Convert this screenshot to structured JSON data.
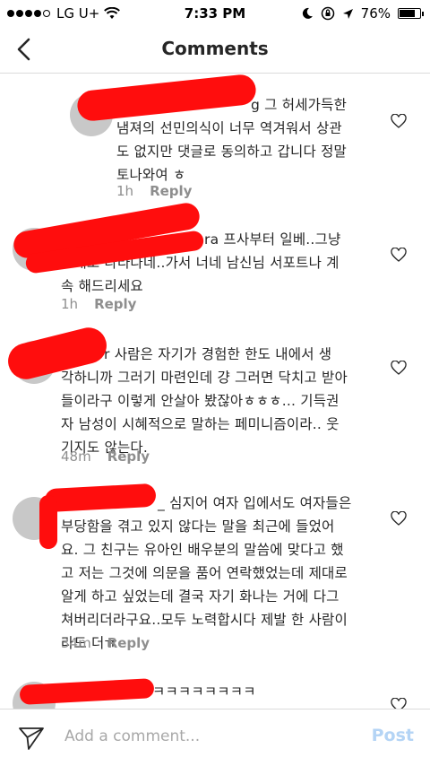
{
  "status_bar": {
    "carrier": "LG U+",
    "time": "7:33 PM",
    "battery": "76%",
    "battery_level": 0.76
  },
  "nav": {
    "title": "Comments"
  },
  "comments": [
    {
      "lines": [
        "g 그 허세가득한",
        "냄져의 선민의식이 너무 역겨워서 상관",
        "도 없지만 댓글로 동의하고 갑니다 정말",
        "토나와여 ㅎ"
      ],
      "time": "1h",
      "reply": "Reply"
    },
    {
      "lines": [
        "ra 프사부터 일베..그냥",
        "그대로 나타나네..가서 너네 남신님 서포트나 계",
        "속 해드리세요"
      ],
      "time": "1h",
      "reply": "Reply"
    },
    {
      "lines": [
        "r 사람은 자기가 경험한 한도 내에서 생",
        "각하니까 그러기 마련인데 걍 그러면 닥치고 받아",
        "들이라구 이렇게 안살아 봤잖아ㅎㅎㅎ... 기득권",
        "자 남성이 시혜적으로 말하는 페미니즘이라.. 웃",
        "기지도 않는다."
      ],
      "time": "48m",
      "reply": "Reply"
    },
    {
      "lines": [
        "_ 심지어 여자 입에서도 여자들은",
        "부당함을 겪고 있지 않다는 말을 최근에 들었어",
        "요. 그 친구는 유아인 배우분의 말씀에 맞다고 했",
        "고 저는 그것에 의문을 품어 연락했었는데 제대로",
        "알게 하고 싶었는데 결국 자기 화나는 거에 다그",
        "쳐버리더라구요..모두 노력합시다 제발 한 사람이",
        "라도 더ㅠ"
      ],
      "time": "34m",
      "reply": "Reply"
    },
    {
      "lines": [
        "ㅋㅋㅋㅋㅋㅋㅋㅋ"
      ],
      "time": "",
      "reply": ""
    }
  ],
  "bottom_bar": {
    "placeholder": "Add a comment...",
    "post_label": "Post"
  },
  "colors": {
    "redaction": "#ff0d0d",
    "post_disabled": "#b4d4f5",
    "meta_gray": "#8e8e8e"
  },
  "icons": [
    "back-arrow-icon",
    "heart-outline-icon",
    "send-direct-icon",
    "wifi-icon",
    "moon-icon",
    "location-arrow-icon",
    "orientation-lock-icon",
    "battery-icon"
  ]
}
